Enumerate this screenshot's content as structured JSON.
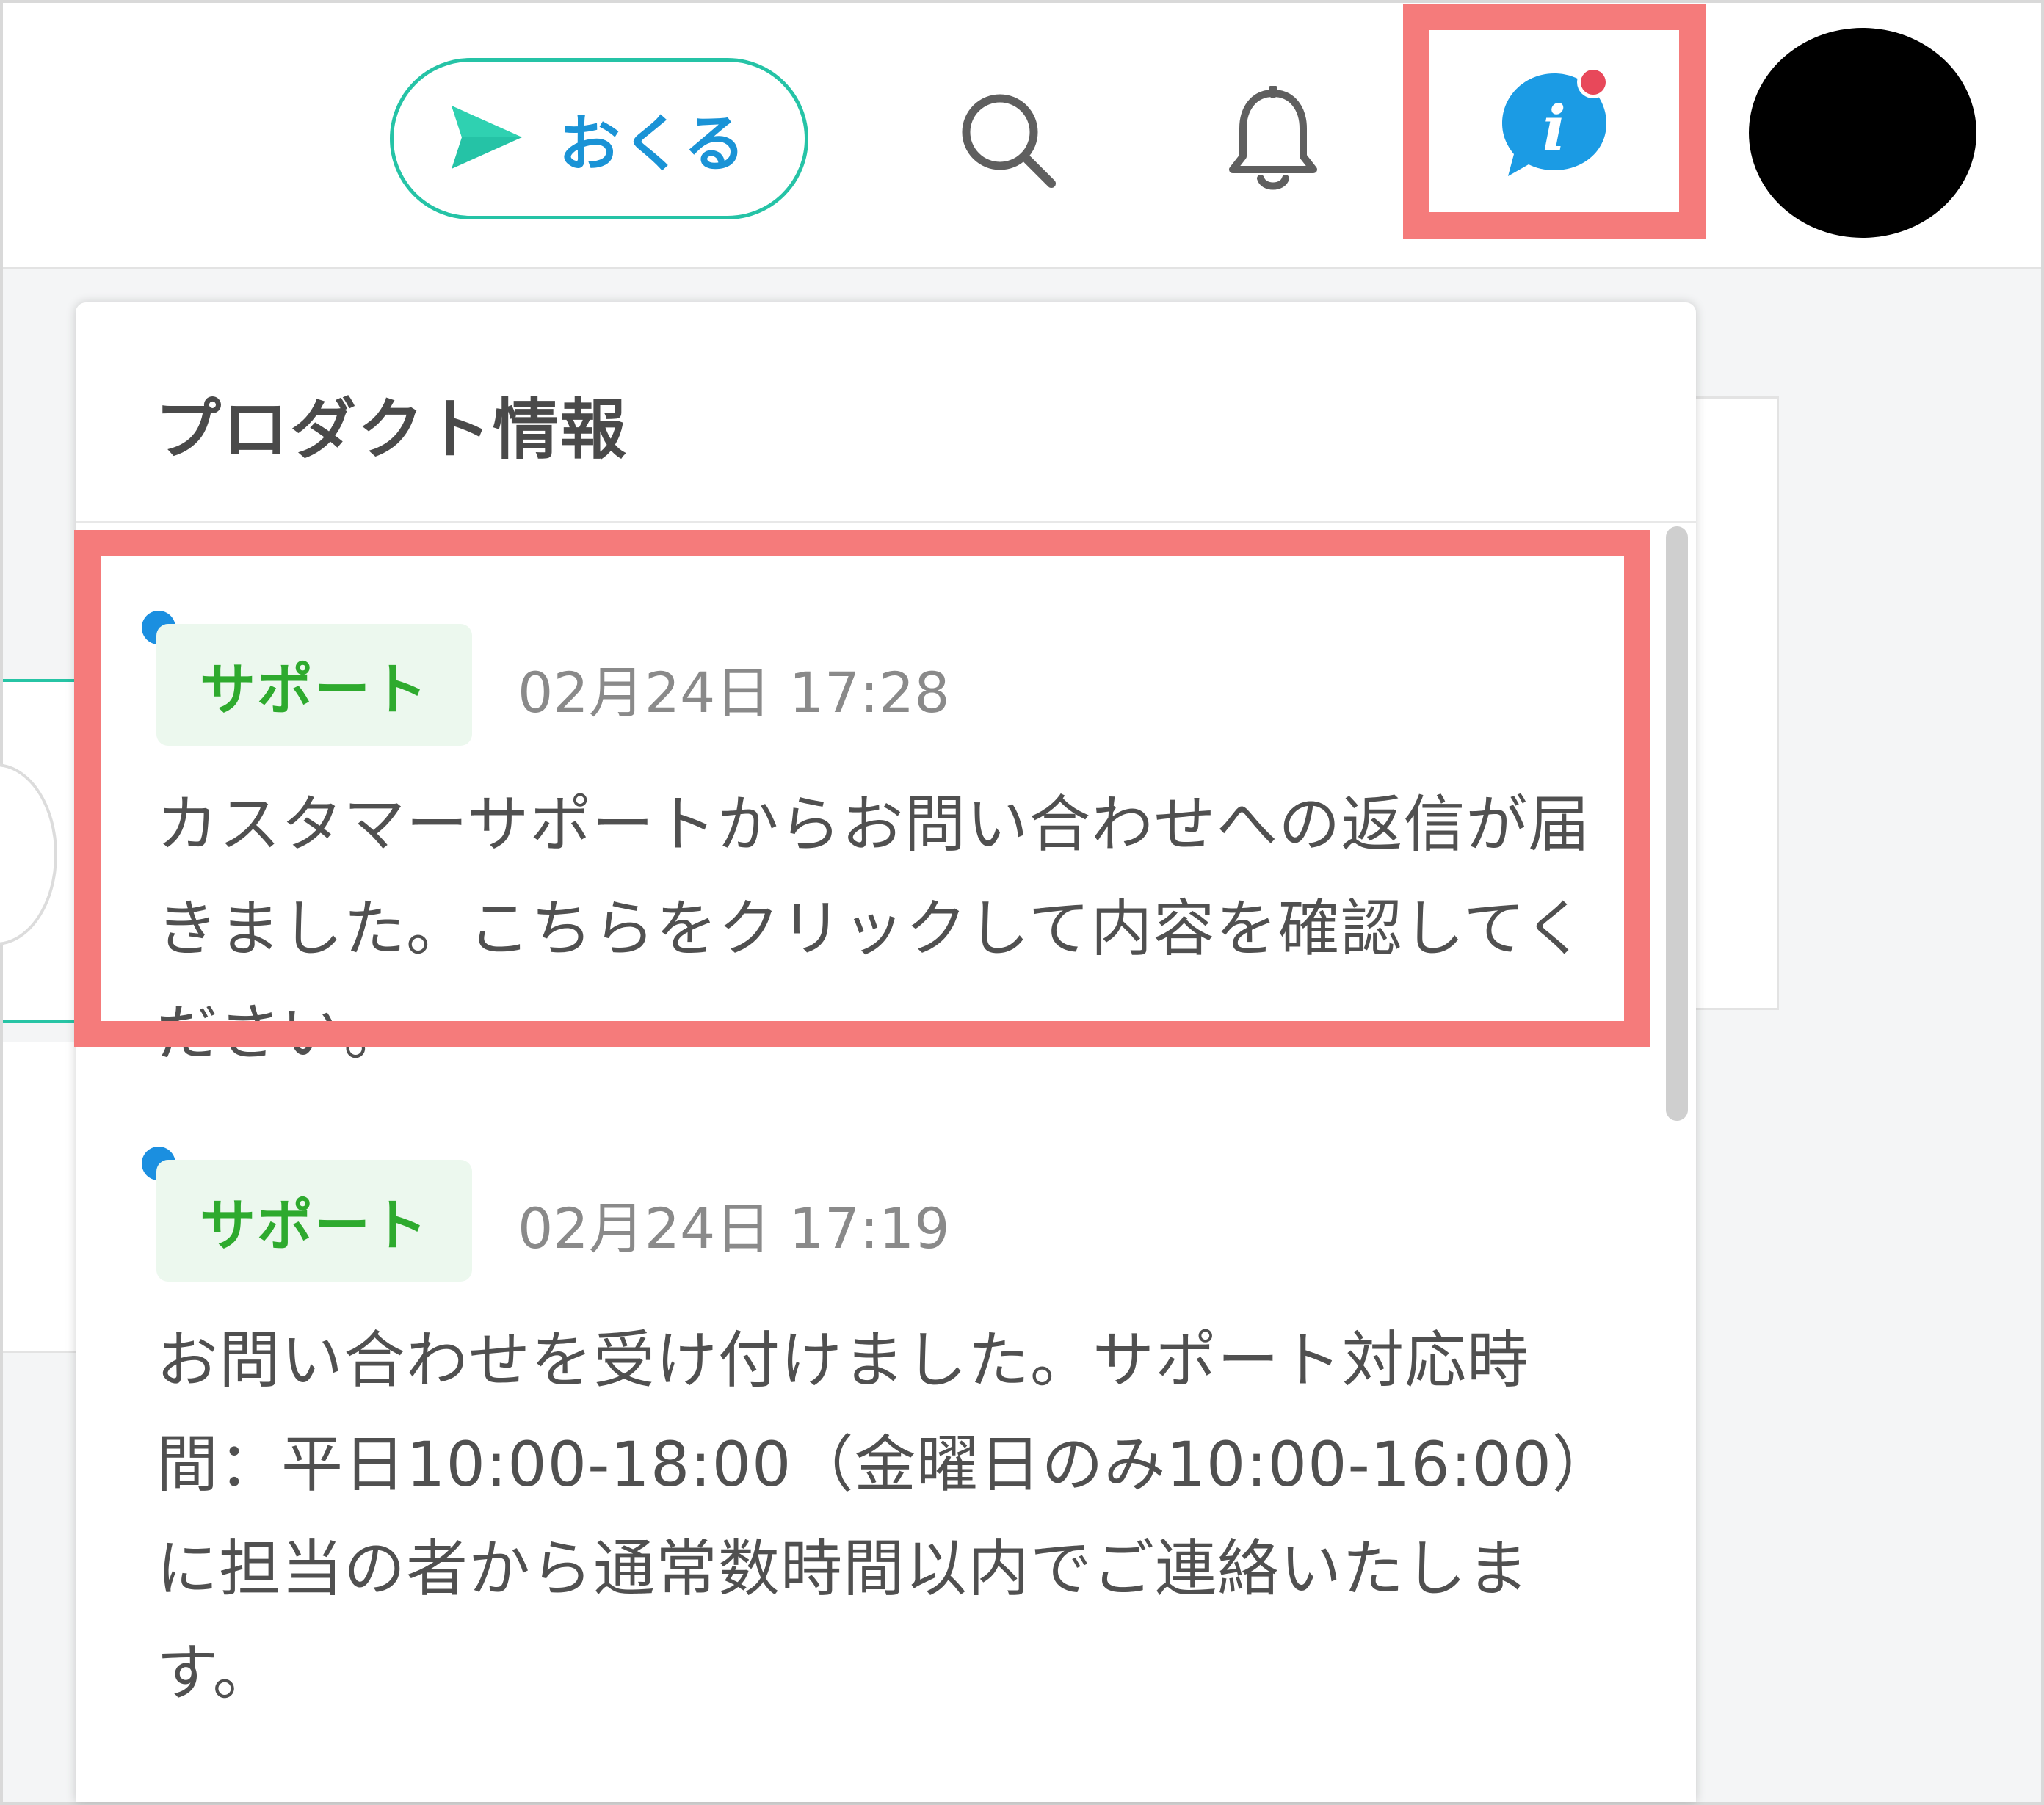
{
  "header": {
    "send_button_label": "おくる",
    "icons": {
      "send": "send-arrow-icon",
      "search": "search-icon",
      "notifications": "bell-icon",
      "product_info": "info-chat-icon"
    },
    "info_badge_color": "#e8485a",
    "accent_color": "#25c3a6",
    "send_label_color": "#1a93d6"
  },
  "panel": {
    "title": "プロダクト情報",
    "items": [
      {
        "unread": true,
        "tag": "サポート",
        "timestamp": "02月24日 17:28",
        "message": "カスタマーサポートからお問い合わせへの返信が届きました。こちらをクリックして内容を確認してください。",
        "highlighted": true
      },
      {
        "unread": true,
        "tag": "サポート",
        "timestamp": "02月24日 17:19",
        "message": "お問い合わせを受け付けました。サポート対応時間：平日10:00-18:00（金曜日のみ10:00-16:00）に担当の者から通常数時間以内でご連絡いたします。",
        "highlighted": false
      }
    ]
  },
  "colors": {
    "highlight": "#f57b7b",
    "unread_dot": "#1b8fe0",
    "tag_text": "#2eaa2e",
    "tag_background": "#ecf8ee"
  }
}
